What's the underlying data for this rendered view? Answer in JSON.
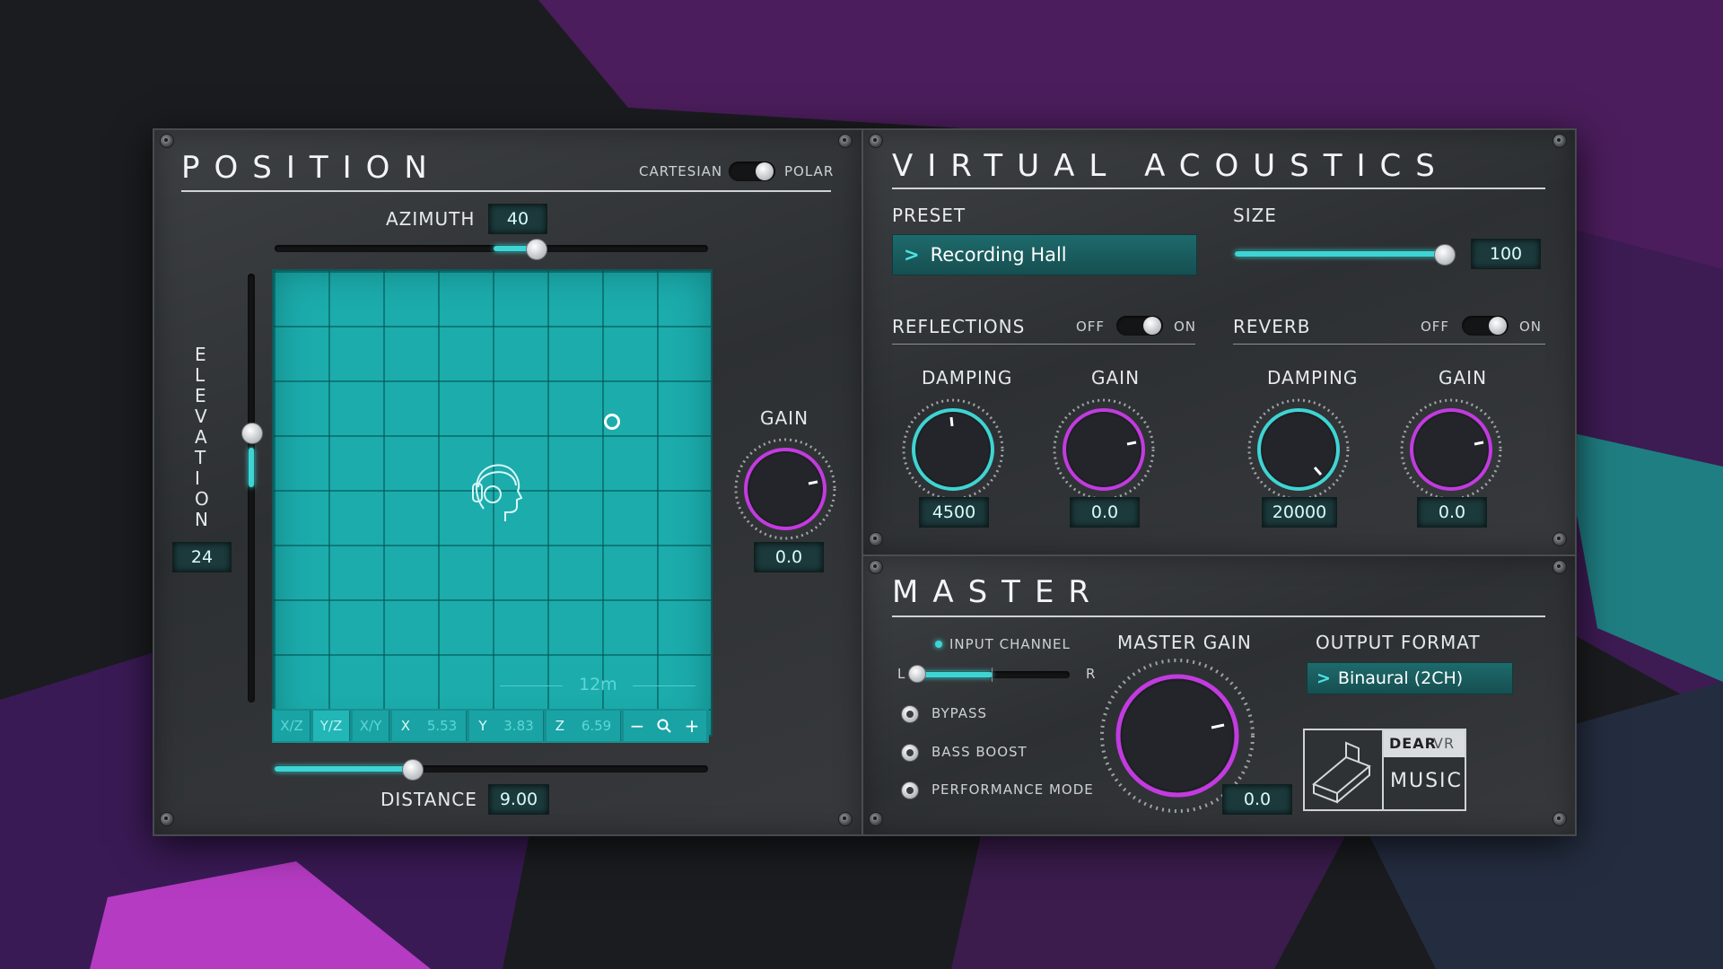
{
  "position": {
    "title": "POSITION",
    "mode_left": "CARTESIAN",
    "mode_right": "POLAR",
    "azimuth_label": "AZIMUTH",
    "azimuth_value": "40",
    "elevation_label": [
      "E",
      "L",
      "E",
      "V",
      "A",
      "T",
      "I",
      "O",
      "N"
    ],
    "elevation_value": "24",
    "gain_label": "GAIN",
    "gain_value": "0.0",
    "distance_label": "DISTANCE",
    "distance_value": "9.00",
    "scale_label": "12m",
    "toolbar": {
      "xz": "X/Z",
      "yz": "Y/Z",
      "xy": "X/Y",
      "x_label": "X",
      "x_value": "5.53",
      "y_label": "Y",
      "y_value": "3.83",
      "z_label": "Z",
      "z_value": "6.59",
      "minus": "−",
      "plus": "+"
    }
  },
  "virtual_acoustics": {
    "title": "VIRTUAL ACOUSTICS",
    "preset_label": "PRESET",
    "preset_value": "Recording Hall",
    "size_label": "SIZE",
    "size_value": "100",
    "reflections_label": "REFLECTIONS",
    "reverb_label": "REVERB",
    "off": "OFF",
    "on": "ON",
    "damping_label": "DAMPING",
    "gain_label": "GAIN",
    "refl_damping_value": "4500",
    "refl_gain_value": "0.0",
    "rev_damping_value": "20000",
    "rev_gain_value": "0.0"
  },
  "master": {
    "title": "MASTER",
    "input_channel_label": "INPUT CHANNEL",
    "left": "L",
    "right": "R",
    "bypass": "BYPASS",
    "bass_boost": "BASS BOOST",
    "performance_mode": "PERFORMANCE MODE",
    "master_gain_label": "MASTER GAIN",
    "master_gain_value": "0.0",
    "output_format_label": "OUTPUT FORMAT",
    "output_format_value": "Binaural (2CH)"
  },
  "logo": {
    "brand_top_bold": "DEAR",
    "brand_top_light": "VR",
    "brand_bottom": "MUSIC"
  },
  "colors": {
    "accent_teal": "#3fd4d4",
    "accent_magenta": "#c23be0"
  }
}
